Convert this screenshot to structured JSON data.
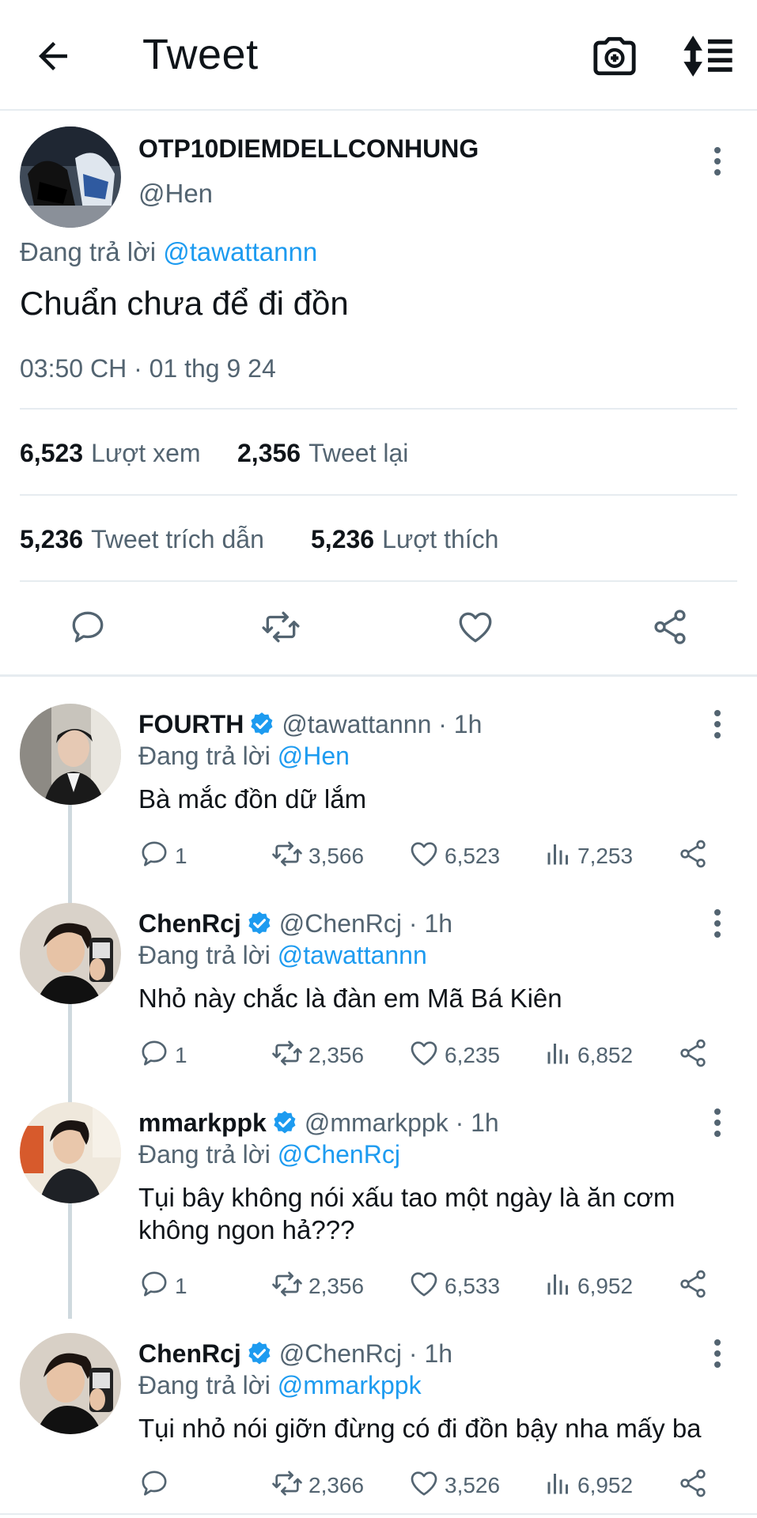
{
  "header": {
    "title": "Tweet"
  },
  "main_tweet": {
    "name": "OTP10DIEMDELLCONHUNG",
    "handle": "@Hen",
    "reply_prefix": "Đang trả lời",
    "reply_to": "@tawattannn",
    "text": "Chuẩn chưa để đi đồn",
    "timestamp": "03:50 CH · 01 thg 9 24",
    "stats": {
      "views_count": "6,523",
      "views_label": "Lượt xem",
      "retweets_count": "2,356",
      "retweets_label": "Tweet lại",
      "quotes_count": "5,236",
      "quotes_label": "Tweet trích dẫn",
      "likes_count": "5,236",
      "likes_label": "Lượt thích"
    }
  },
  "replies": [
    {
      "name": "FOURTH",
      "handle": "@tawattannn",
      "time": "· 1h",
      "reply_prefix": "Đang trả lời",
      "reply_to": "@Hen",
      "text": "Bà mắc đồn dữ lắm",
      "replies": "1",
      "retweets": "3,566",
      "likes": "6,523",
      "views": "7,253"
    },
    {
      "name": "ChenRcj",
      "handle": "@ChenRcj",
      "time": "· 1h",
      "reply_prefix": "Đang trả lời",
      "reply_to": "@tawattannn",
      "text": "Nhỏ này chắc là đàn em Mã Bá Kiên",
      "replies": "1",
      "retweets": "2,356",
      "likes": "6,235",
      "views": "6,852"
    },
    {
      "name": "mmarkppk",
      "handle": "@mmarkppk",
      "time": "· 1h",
      "reply_prefix": "Đang trả lời",
      "reply_to": "@ChenRcj",
      "text": "Tụi bây không nói xấu tao một ngày là ăn cơm không ngon hả???",
      "replies": "1",
      "retweets": "2,356",
      "likes": "6,533",
      "views": "6,952"
    },
    {
      "name": "ChenRcj",
      "handle": "@ChenRcj",
      "time": "· 1h",
      "reply_prefix": "Đang trả lời",
      "reply_to": "@mmarkppk",
      "text": "Tụi nhỏ nói giỡn đừng có đi đồn bậy nha mấy ba",
      "replies": "",
      "retweets": "2,366",
      "likes": "3,526",
      "views": "6,952"
    }
  ],
  "icons": {
    "back": "arrow-left-icon",
    "camera": "camera-plus-icon",
    "sort": "sort-icon",
    "reply": "comment-icon",
    "retweet": "retweet-icon",
    "like": "heart-icon",
    "views": "bar-chart-icon",
    "share": "share-icon",
    "more": "more-vertical-icon",
    "verified": "verified-badge-icon"
  },
  "colors": {
    "accent": "#1d9bf0",
    "muted": "#536471",
    "text": "#0f1419",
    "divider": "#e6ecf0"
  }
}
